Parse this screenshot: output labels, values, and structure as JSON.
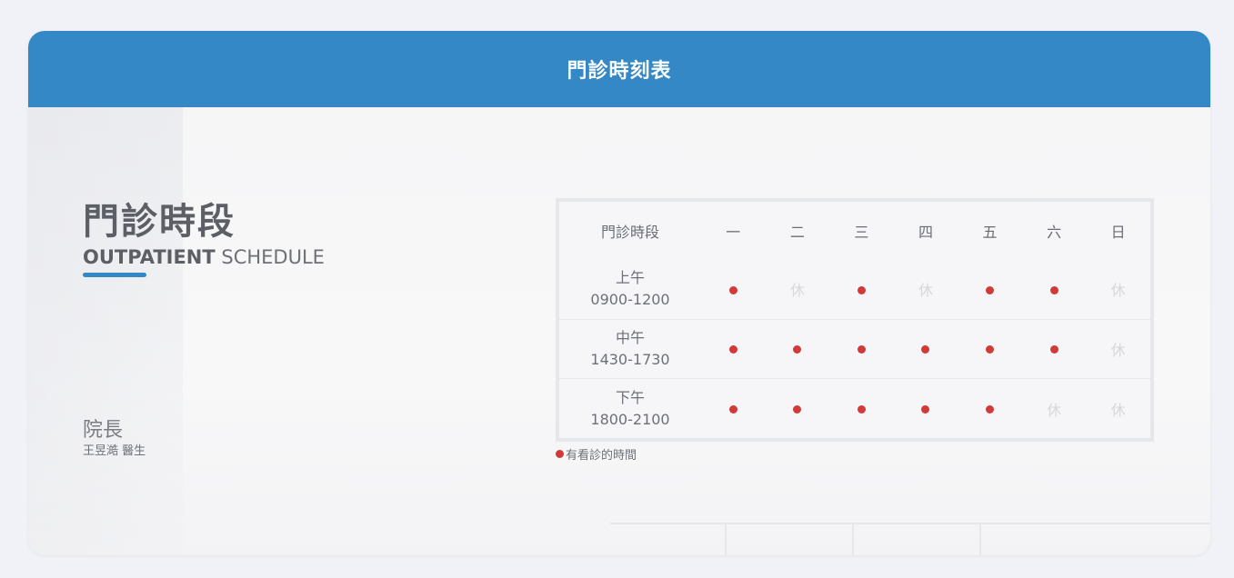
{
  "header": {
    "title": "門診時刻表"
  },
  "section": {
    "title_zh": "門診時段",
    "title_en_strong": "OUTPATIENT",
    "title_en_rest": " SCHEDULE"
  },
  "doctor": {
    "role": "院長",
    "name": "王昱澔  醫生"
  },
  "schedule": {
    "slot_header": "門診時段",
    "days": [
      "一",
      "二",
      "三",
      "四",
      "五",
      "六",
      "日"
    ],
    "closed_label": "休",
    "rows": [
      {
        "name": "上午",
        "time": "0900-1200",
        "open": [
          true,
          false,
          true,
          false,
          true,
          true,
          false
        ]
      },
      {
        "name": "中午",
        "time": "1430-1730",
        "open": [
          true,
          true,
          true,
          true,
          true,
          true,
          false
        ]
      },
      {
        "name": "下午",
        "time": "1800-2100",
        "open": [
          true,
          true,
          true,
          true,
          true,
          false,
          false
        ]
      }
    ]
  },
  "legend": {
    "text": "有看診的時間"
  },
  "colors": {
    "accent": "#3488c6",
    "open_dot": "#d23a3a",
    "closed_text": "#d6d7da"
  }
}
